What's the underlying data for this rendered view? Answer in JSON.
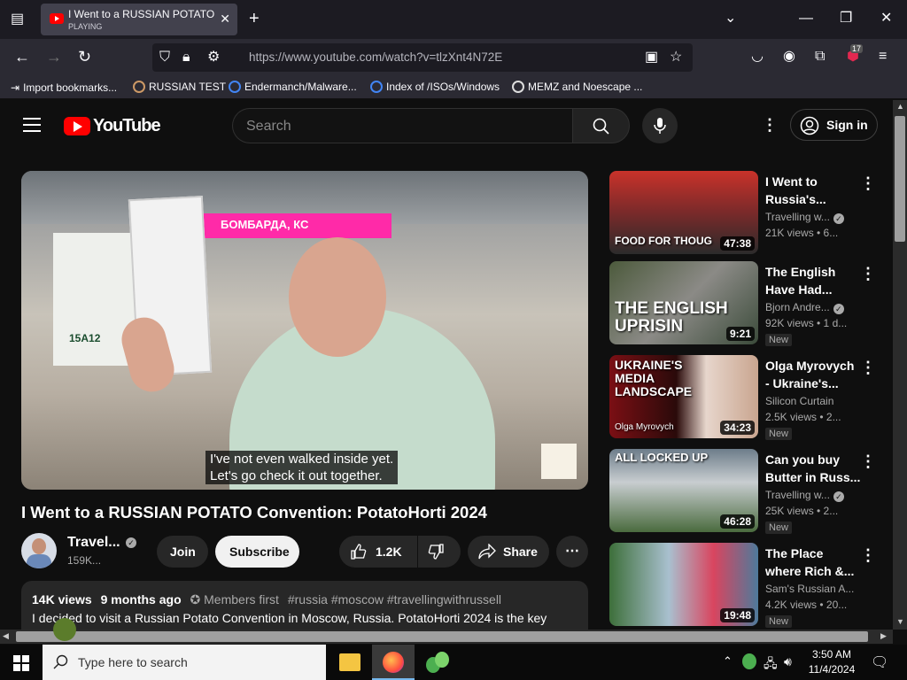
{
  "browser": {
    "tab_title": "I Went to a RUSSIAN POTATO Co",
    "tab_status": "PLAYING",
    "url": "https://www.youtube.com/watch?v=tlzXnt4N72E",
    "badge_count": "17",
    "bookmarks": [
      {
        "label": "Import bookmarks...",
        "icon": "import-icon"
      },
      {
        "label": "RUSSIAN TEST",
        "icon": "site-icon"
      },
      {
        "label": "Endermanch/Malware...",
        "icon": "google-icon"
      },
      {
        "label": "Index of /ISOs/Windows",
        "icon": "google-icon"
      },
      {
        "label": "MEMZ and Noescape ...",
        "icon": "globe-icon"
      }
    ]
  },
  "youtube": {
    "logo_text": "YouTube",
    "search_placeholder": "Search",
    "sign_in": "Sign in",
    "video": {
      "caption_line1": "I've not even walked inside yet.",
      "caption_line2": "Let's go check it out together.",
      "title": "I Went to a RUSSIAN POTATO Convention: PotatoHorti 2024",
      "sign_text": "БОМБАРДА, КС",
      "booth_text": "15A12"
    },
    "channel": {
      "name": "Travel...",
      "subscribers": "159K...",
      "join": "Join",
      "subscribe": "Subscribe"
    },
    "actions": {
      "likes": "1.2K",
      "share": "Share"
    },
    "description": {
      "views": "14K views",
      "date": "9 months ago",
      "members": "Members first",
      "tags": "#russia #moscow #travellingwithrussell",
      "text": "I decided to visit a Russian Potato Convention in Moscow, Russia. PotatoHorti 2024 is the key"
    },
    "recommendations": [
      {
        "title1": "I Went to",
        "title2": "Russia's...",
        "channel": "Travelling w...",
        "verified": true,
        "meta": "21K views • 6...",
        "duration": "47:38",
        "overlay": "FOOD FOR THOUG",
        "new": ""
      },
      {
        "title1": "The English",
        "title2": "Have Had...",
        "channel": "Bjorn Andre...",
        "verified": true,
        "meta": "92K views • 1 d...",
        "duration": "9:21",
        "overlay": "THE ENGLISH UPRISIN",
        "new": "New"
      },
      {
        "title1": "Olga Myrovych",
        "title2": "- Ukraine's...",
        "channel": "Silicon Curtain",
        "verified": false,
        "meta": "2.5K views • 2...",
        "duration": "34:23",
        "overlay": "UKRAINE'S MEDIA LANDSCAPE",
        "overlay_sub": "Olga Myrovych",
        "new": "New"
      },
      {
        "title1": "Can you buy",
        "title2": "Butter in Russ...",
        "channel": "Travelling w...",
        "verified": true,
        "meta": "25K views • 2...",
        "duration": "46:28",
        "overlay": "ALL LOCKED UP",
        "new": "New"
      },
      {
        "title1": "The Place",
        "title2": "where Rich &...",
        "channel": "Sam's Russian A...",
        "verified": false,
        "meta": "4.2K views • 20...",
        "duration": "19:48",
        "overlay": "",
        "new": "New"
      }
    ]
  },
  "taskbar": {
    "search_placeholder": "Type here to search",
    "time": "3:50 AM",
    "date": "11/4/2024"
  },
  "colors": {
    "youtube_red": "#ff0000",
    "background": "#0f0f0f",
    "chip": "#272727",
    "firefox_toolbar": "#2b2a33"
  }
}
